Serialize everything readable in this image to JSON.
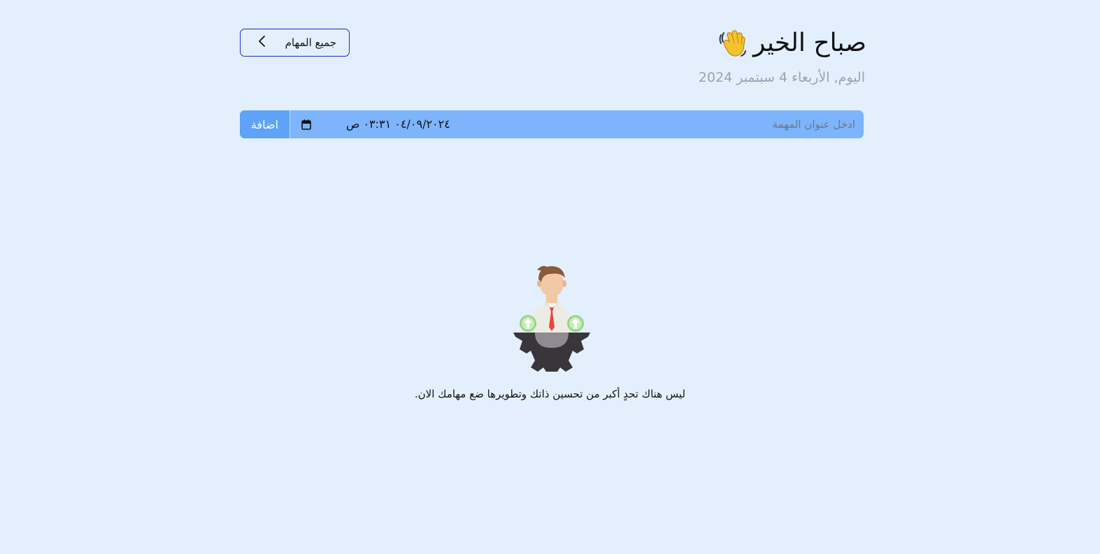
{
  "header": {
    "greeting": "صباح الخير",
    "greeting_icon": "waving-hand-icon",
    "date_text": "اليوم, الأربعاء 4 سبتمبر 2024"
  },
  "nav": {
    "all_tasks_label": "جميع المهام",
    "all_tasks_icon": "chevron-left-icon"
  },
  "task_form": {
    "add_label": "اضافة",
    "datetime_value": "٠٤/٠٩/٢٠٢٤ ٠٣:٣١ ص",
    "title_placeholder": "ادخل عنوان المهمة",
    "calendar_icon": "calendar-icon"
  },
  "empty_state": {
    "illustration": "person-gear-growth-illustration",
    "message": ".ليس هناك تحدٍ أكبر من تحسين ذاتك وتطويرها ضع مهامك الان"
  },
  "colors": {
    "background": "#e3effd",
    "input_bar": "#7db4fb",
    "add_button": "#5ea3f7",
    "outline_button_border": "#1c2ad8"
  }
}
